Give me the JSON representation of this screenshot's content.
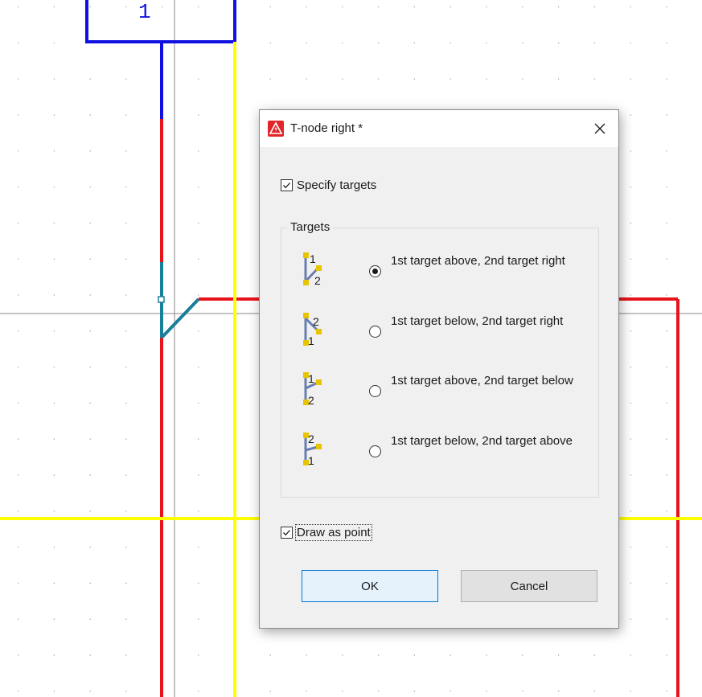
{
  "background": {
    "grid_color": "#9a9a9a",
    "wire_colors": {
      "red": "#e8141c",
      "blue": "#1010e0",
      "yellow": "#ffff00",
      "teal": "#1a7f9a",
      "gray": "#888888"
    },
    "partial_glyph": "1"
  },
  "dialog": {
    "title": "T-node right *",
    "title_icon": "app-warning-icon",
    "close_icon": "close-icon",
    "specify_targets": {
      "label": "Specify targets",
      "checked": true
    },
    "targets_group_title": "Targets",
    "options": [
      {
        "label": "1st target above, 2nd target right",
        "icon": "tnode-above-right-icon",
        "selected": true
      },
      {
        "label": "1st target below, 2nd target right",
        "icon": "tnode-below-right-icon",
        "selected": false
      },
      {
        "label": "1st target above, 2nd target below",
        "icon": "tnode-above-below-icon",
        "selected": false
      },
      {
        "label": "1st target below, 2nd target above",
        "icon": "tnode-below-above-icon",
        "selected": false
      }
    ],
    "draw_as_point": {
      "label": "Draw as point",
      "checked": true
    },
    "ok_label": "OK",
    "cancel_label": "Cancel"
  }
}
